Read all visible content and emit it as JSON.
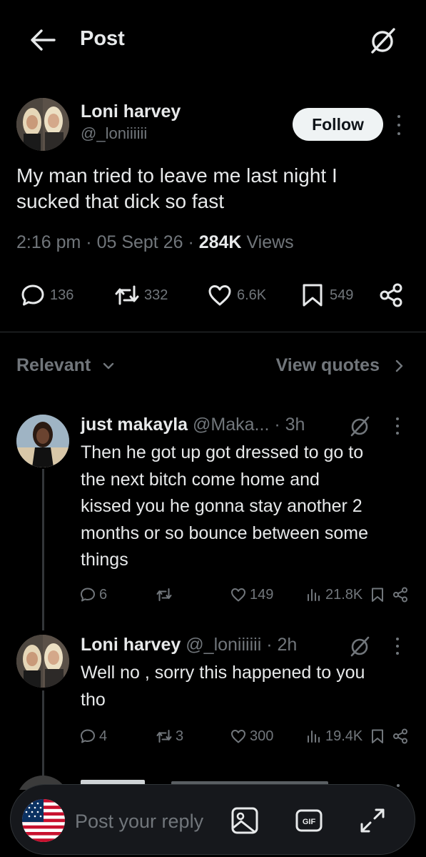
{
  "header": {
    "title": "Post"
  },
  "post": {
    "author_name": "Loni harvey",
    "author_handle": "@_loniiiiii",
    "follow_label": "Follow",
    "text_line1": "My man tried to leave me last night I",
    "text_line2": "sucked that dick so fast",
    "time": "2:16 pm",
    "date": "05 Sept 26",
    "views_count": "284K",
    "views_label": "Views",
    "stats": {
      "replies": "136",
      "reposts": "332",
      "likes": "6.6K",
      "bookmarks": "549"
    }
  },
  "filters": {
    "sort_label": "Relevant",
    "quotes_label": "View quotes"
  },
  "replies": [
    {
      "name": "just makayla",
      "handle": "@Maka...",
      "time": "· 3h",
      "lines": [
        "Then he got up got dressed to go to",
        "the next bitch come home and",
        "kissed you he gonna stay another 2",
        "months or so bounce between some",
        "things"
      ],
      "stats": {
        "replies": "6",
        "reposts": "",
        "likes": "149",
        "views": "21.8K"
      }
    },
    {
      "name": "Loni harvey",
      "handle": "@_loniiiiii",
      "time": "· 2h",
      "lines": [
        "Well no , sorry this happened to you",
        "tho"
      ],
      "stats": {
        "replies": "4",
        "reposts": "3",
        "likes": "300",
        "views": "19.4K"
      }
    }
  ],
  "reply_bar": {
    "placeholder": "Post your reply"
  },
  "icons": {
    "back": "arrow-left-icon",
    "grok": "grok-icon",
    "reply": "speech-bubble-icon",
    "repost": "repost-icon",
    "like": "heart-icon",
    "bookmark": "bookmark-icon",
    "share": "share-icon",
    "views": "bar-chart-icon",
    "image": "image-icon",
    "gif": "gif-icon",
    "expand": "expand-icon",
    "flag": "us-flag-icon"
  },
  "colors": {
    "background": "#000000",
    "text": "#e7e9ea",
    "muted": "#71767b",
    "divider": "#2f3336",
    "follow_bg": "#eff3f4"
  }
}
